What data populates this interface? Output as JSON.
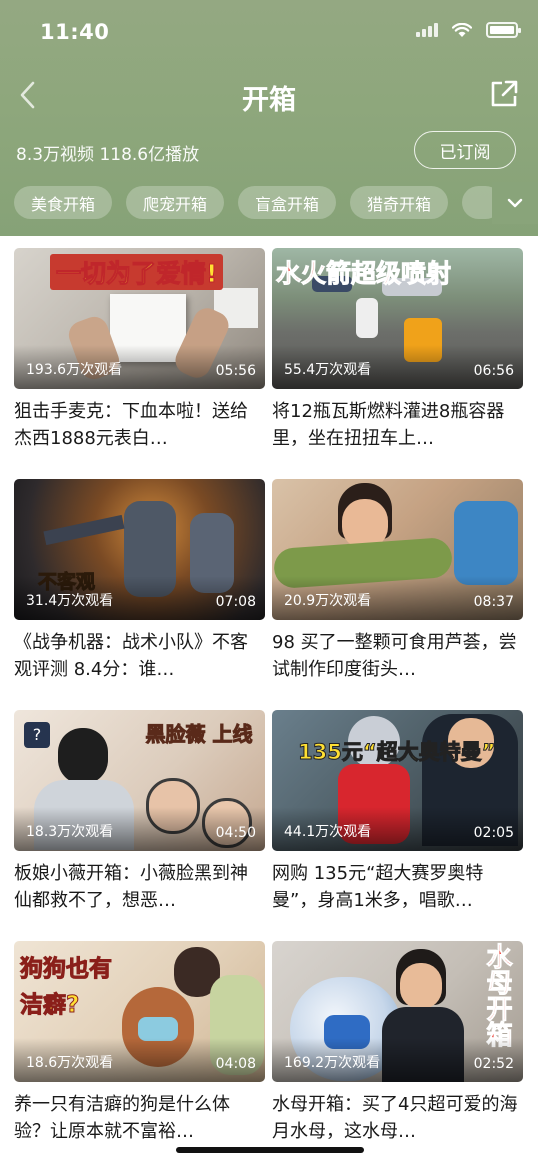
{
  "status_bar": {
    "time": "11:40"
  },
  "header": {
    "title": "开箱",
    "stats": "8.3万视频 118.6亿播放",
    "subscribe_label": "已订阅"
  },
  "tags": [
    "美食开箱",
    "爬宠开箱",
    "盲盒开箱",
    "猎奇开箱"
  ],
  "videos": [
    {
      "views": "193.6万次观看",
      "duration": "05:56",
      "title": "狙击手麦克：下血本啦！送给杰西1888元表白…",
      "caption": "一切为了爱情!"
    },
    {
      "views": "55.4万次观看",
      "duration": "06:56",
      "title": "将12瓶瓦斯燃料灌进8瓶容器里，坐在扭扭车上…",
      "caption": "水火箭超级喷射"
    },
    {
      "views": "31.4万次观看",
      "duration": "07:08",
      "title": "《战争机器：战术小队》不客观评测 8.4分：谁…",
      "caption": "不客观"
    },
    {
      "views": "20.9万次观看",
      "duration": "08:37",
      "title": "98 买了一整颗可食用芦荟，尝试制作印度街头…",
      "caption": ""
    },
    {
      "views": "18.3万次观看",
      "duration": "04:50",
      "title": "板娘小薇开箱：小薇脸黑到神仙都救不了，想恶…",
      "caption": "黑脸薇 上线"
    },
    {
      "views": "44.1万次观看",
      "duration": "02:05",
      "title": "网购 135元“超大赛罗奥特曼”，身高1米多，唱歌…",
      "caption": "135元“超大奥特曼”"
    },
    {
      "views": "18.6万次观看",
      "duration": "04:08",
      "title": "养一只有洁癖的狗是什么体验？让原本就不富裕…",
      "caption": "狗狗也有 洁癖?"
    },
    {
      "views": "169.2万次观看",
      "duration": "02:52",
      "title": "水母开箱：买了4只超可爱的海月水母，这水母…",
      "caption": "水母开箱"
    }
  ],
  "colors": {
    "header_bg": "#8ea77c",
    "caption_yellow": "#ffe033",
    "caption_red": "#e8352a"
  }
}
